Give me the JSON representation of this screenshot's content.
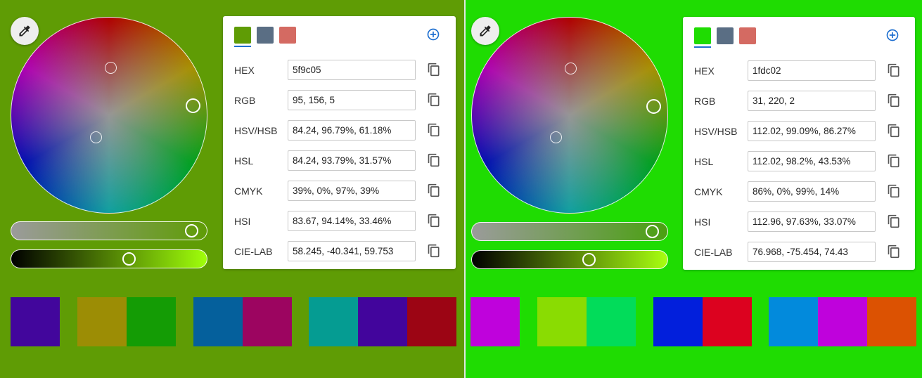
{
  "left": {
    "bg": "#5f9c05",
    "swatches": [
      "#5f9c05",
      "#5a6e84",
      "#d46a62"
    ],
    "rows": [
      {
        "label": "HEX",
        "value": "5f9c05"
      },
      {
        "label": "RGB",
        "value": "95, 156, 5"
      },
      {
        "label": "HSV/HSB",
        "value": "84.24, 96.79%, 61.18%"
      },
      {
        "label": "HSL",
        "value": "84.24, 93.79%, 31.57%"
      },
      {
        "label": "CMYK",
        "value": "39%, 0%, 97%, 39%"
      },
      {
        "label": "HSI",
        "value": "83.67, 94.14%, 33.46%"
      },
      {
        "label": "CIE-LAB",
        "value": "58.245, -40.341, 59.753"
      }
    ],
    "palettes": [
      [
        "#42069c"
      ],
      [
        "#9c8d05",
        "#149c05"
      ],
      [
        "#05609c",
        "#9c0560"
      ],
      [
        "#059c92",
        "#42059c",
        "#9c0514"
      ]
    ]
  },
  "right": {
    "bg": "#1fdc02",
    "swatches": [
      "#1fdc02",
      "#5a6e84",
      "#d46a62"
    ],
    "rows": [
      {
        "label": "HEX",
        "value": "1fdc02"
      },
      {
        "label": "RGB",
        "value": "31, 220, 2"
      },
      {
        "label": "HSV/HSB",
        "value": "112.02, 99.09%, 86.27%"
      },
      {
        "label": "HSL",
        "value": "112.02, 98.2%, 43.53%"
      },
      {
        "label": "CMYK",
        "value": "86%, 0%, 99%, 14%"
      },
      {
        "label": "HSI",
        "value": "112.96, 97.63%, 33.07%"
      },
      {
        "label": "CIE-LAB",
        "value": "76.968, -75.454, 74.43"
      }
    ],
    "palettes": [
      [
        "#bf02dc"
      ],
      [
        "#8adc02",
        "#02dc5a"
      ],
      [
        "#021fdc",
        "#dc021f"
      ],
      [
        "#028adc",
        "#bf02dc",
        "#dc5202"
      ]
    ]
  },
  "icons": {
    "eyedropper": "eyedropper-icon",
    "add": "add-circle-icon",
    "copy": "copy-icon"
  }
}
